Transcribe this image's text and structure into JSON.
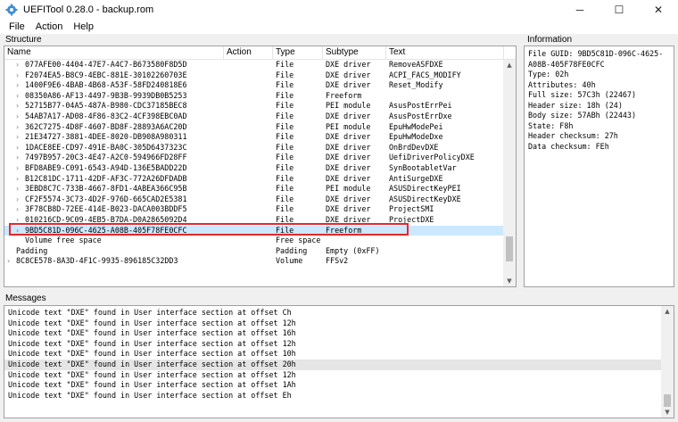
{
  "window": {
    "title": "UEFITool 0.28.0 - backup.rom",
    "minimize_glyph": "─",
    "maximize_glyph": "☐",
    "close_glyph": "✕"
  },
  "menu": [
    "File",
    "Action",
    "Help"
  ],
  "structure": {
    "label": "Structure",
    "columns": [
      "Name",
      "Action",
      "Type",
      "Subtype",
      "Text"
    ],
    "rows": [
      {
        "expander": true,
        "indent": 1,
        "name": "077AFE00-4404-47E7-A4C7-B673580F8D5D",
        "action": "",
        "type": "File",
        "subtype": "DXE driver",
        "text": "RemoveASFDXE"
      },
      {
        "expander": true,
        "indent": 1,
        "name": "F2074EA5-B8C9-4EBC-881E-30102260703E",
        "action": "",
        "type": "File",
        "subtype": "DXE driver",
        "text": "ACPI_FACS_MODIFY"
      },
      {
        "expander": true,
        "indent": 1,
        "name": "1400F9E6-4BAB-4B68-A53F-58FD240818E6",
        "action": "",
        "type": "File",
        "subtype": "DXE driver",
        "text": "Reset_Modify"
      },
      {
        "expander": true,
        "indent": 1,
        "name": "08350A86-AF13-4497-9B3B-9939DB0B5253",
        "action": "",
        "type": "File",
        "subtype": "Freeform",
        "text": ""
      },
      {
        "expander": true,
        "indent": 1,
        "name": "52715B77-04A5-487A-B980-CDC37185BEC8",
        "action": "",
        "type": "File",
        "subtype": "PEI module",
        "text": "AsusPostErrPei"
      },
      {
        "expander": true,
        "indent": 1,
        "name": "54AB7A17-AD08-4F86-83C2-4CF398EBC0AD",
        "action": "",
        "type": "File",
        "subtype": "DXE driver",
        "text": "AsusPostErrDxe"
      },
      {
        "expander": true,
        "indent": 1,
        "name": "362C7275-4D8F-4607-BD8F-28893A6AC20D",
        "action": "",
        "type": "File",
        "subtype": "PEI module",
        "text": "EpuHwModePei"
      },
      {
        "expander": true,
        "indent": 1,
        "name": "21E34727-3881-4DEE-8020-DB908A980311",
        "action": "",
        "type": "File",
        "subtype": "DXE driver",
        "text": "EpuHwModeDxe"
      },
      {
        "expander": true,
        "indent": 1,
        "name": "1DACE8EE-CD97-491E-BA0C-305D6437323C",
        "action": "",
        "type": "File",
        "subtype": "DXE driver",
        "text": "OnBrdDevDXE"
      },
      {
        "expander": true,
        "indent": 1,
        "name": "7497B957-20C3-4E47-A2C0-594966FD28FF",
        "action": "",
        "type": "File",
        "subtype": "DXE driver",
        "text": "UefiDriverPolicyDXE"
      },
      {
        "expander": true,
        "indent": 1,
        "name": "BFD8ABE9-C091-6543-A94D-136E5BADD22D",
        "action": "",
        "type": "File",
        "subtype": "DXE driver",
        "text": "SynBootabletVar"
      },
      {
        "expander": true,
        "indent": 1,
        "name": "B12C81DC-1711-42DF-AF3C-772A26DFDADB",
        "action": "",
        "type": "File",
        "subtype": "DXE driver",
        "text": "AntiSurgeDXE"
      },
      {
        "expander": true,
        "indent": 1,
        "name": "3EBD8C7C-733B-4667-8FD1-4ABEA366C95B",
        "action": "",
        "type": "File",
        "subtype": "PEI module",
        "text": "ASUSDirectKeyPEI"
      },
      {
        "expander": true,
        "indent": 1,
        "name": "CF2F5574-3C73-4D2F-976D-665CAD2E5381",
        "action": "",
        "type": "File",
        "subtype": "DXE driver",
        "text": "ASUSDirectKeyDXE"
      },
      {
        "expander": true,
        "indent": 1,
        "name": "3F78CB8D-72EE-414E-B023-DACA003BDDF5",
        "action": "",
        "type": "File",
        "subtype": "DXE driver",
        "text": "ProjectSMI"
      },
      {
        "expander": true,
        "indent": 1,
        "name": "010216CD-9C09-4EB5-B7DA-D0A2865092D4",
        "action": "",
        "type": "File",
        "subtype": "DXE driver",
        "text": "ProjectDXE"
      },
      {
        "expander": true,
        "indent": 1,
        "name": "9BD5C81D-096C-4625-A08B-405F78FE0CFC",
        "action": "",
        "type": "File",
        "subtype": "Freeform",
        "text": "",
        "selected": true
      },
      {
        "expander": false,
        "indent": 1,
        "name": "Volume free space",
        "action": "",
        "type": "Free space",
        "subtype": "",
        "text": ""
      },
      {
        "expander": false,
        "indent": 0,
        "name": "Padding",
        "action": "",
        "type": "Padding",
        "subtype": "Empty (0xFF)",
        "text": ""
      },
      {
        "expander": true,
        "indent": 0,
        "name": "8C8CE578-8A3D-4F1C-9935-896185C32DD3",
        "action": "",
        "type": "Volume",
        "subtype": "FFSv2",
        "text": ""
      }
    ],
    "scroll_position": 0.92
  },
  "information": {
    "label": "Information",
    "lines": [
      "File GUID: 9BD5C81D-096C-4625-",
      "A08B-405F78FE0CFC",
      "Type: 02h",
      "Attributes: 40h",
      "Full size: 57C3h (22467)",
      "Header size: 18h (24)",
      "Body size: 57ABh (22443)",
      "State: F8h",
      "Header checksum: 27h",
      "Data checksum: FEh"
    ]
  },
  "messages": {
    "label": "Messages",
    "items": [
      {
        "text": "Unicode text \"DXE\" found in User interface section at offset Ch",
        "highlighted": false
      },
      {
        "text": "Unicode text \"DXE\" found in User interface section at offset 12h",
        "highlighted": false
      },
      {
        "text": "Unicode text \"DXE\" found in User interface section at offset 16h",
        "highlighted": false
      },
      {
        "text": "Unicode text \"DXE\" found in User interface section at offset 12h",
        "highlighted": false
      },
      {
        "text": "Unicode text \"DXE\" found in User interface section at offset 10h",
        "highlighted": false
      },
      {
        "text": "Unicode text \"DXE\" found in User interface section at offset 20h",
        "highlighted": true
      },
      {
        "text": "Unicode text \"DXE\" found in User interface section at offset 12h",
        "highlighted": false
      },
      {
        "text": "Unicode text \"DXE\" found in User interface section at offset 1Ah",
        "highlighted": false
      },
      {
        "text": "Unicode text \"DXE\" found in User interface section at offset Eh",
        "highlighted": false
      }
    ],
    "scroll_position": 1.0
  },
  "colors": {
    "selection": "#cce8ff",
    "annotation_box": "#e8262b",
    "message_highlight": "#e5e5e5"
  }
}
